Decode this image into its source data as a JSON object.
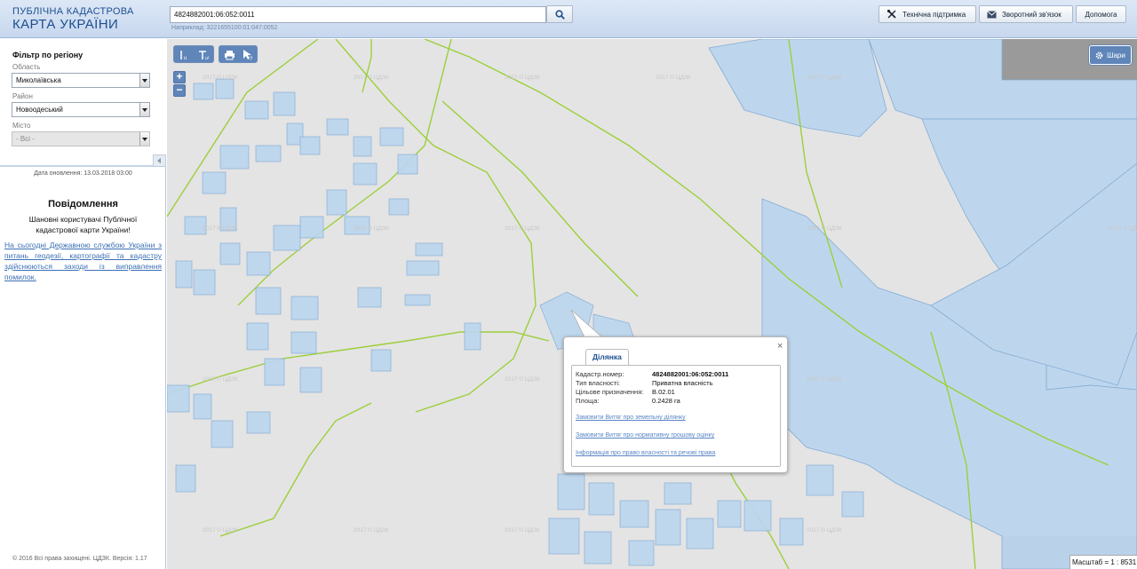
{
  "header": {
    "logo_line1": "ПУБЛІЧНА КАДАСТРОВА",
    "logo_line2": "КАРТА УКРАЇНИ",
    "search_value": "4824882001:06:052:0011",
    "search_hint": "Наприклад: 3221655100:01:047:0052",
    "buttons": {
      "support": "Технічна підтримка",
      "feedback": "Зворотний зв'язок",
      "help": "Допомога"
    }
  },
  "sidebar": {
    "filter_title": "Фільтр по регіону",
    "oblast_label": "Область",
    "oblast_value": "Миколаївська",
    "raion_label": "Район",
    "raion_value": "Новоодеський",
    "misto_label": "Місто",
    "misto_value": "- Всі -",
    "update_date": "Дата оновлення: 13.03.2018 03:00",
    "news_title": "Повідомлення",
    "news_greeting": "Шановні користувачі Публічної кадастрової карти України!",
    "news_link": "На сьогодні Державною службою України з питань геодезії, картографії та кадастру здійснюються заходи із виправлення помилок.",
    "copyright": "© 2016 Всі права захищені. ЦДЗК. Версія: 1.17"
  },
  "map": {
    "layers_label": "Шари",
    "scale_text": "Масштаб = 1 : 8531",
    "watermark": "2017 © ЦДЗК",
    "colors": {
      "parcel_fill": "#bcd6ee",
      "parcel_stroke": "#7fa9d4",
      "boundary": "#9ccf3a",
      "tile": "#e4e4e4",
      "blank": "#9a9a9a"
    }
  },
  "popup": {
    "tab_label": "Ділянка",
    "rows": [
      {
        "label": "Кадастр.номер:",
        "value": "4824882001:06:052:0011"
      },
      {
        "label": "Тип власності:",
        "value": "Приватна власність"
      },
      {
        "label": "Цільове призначення:",
        "value": "В.02.01"
      },
      {
        "label": "Площа:",
        "value": "0.2428 га"
      }
    ],
    "links": [
      "Замовити Витяг про земельну ділянку",
      "Замовити Витяг про нормативну грошову оцінку",
      "Інформація про право власності та речові права"
    ],
    "close": "×"
  }
}
